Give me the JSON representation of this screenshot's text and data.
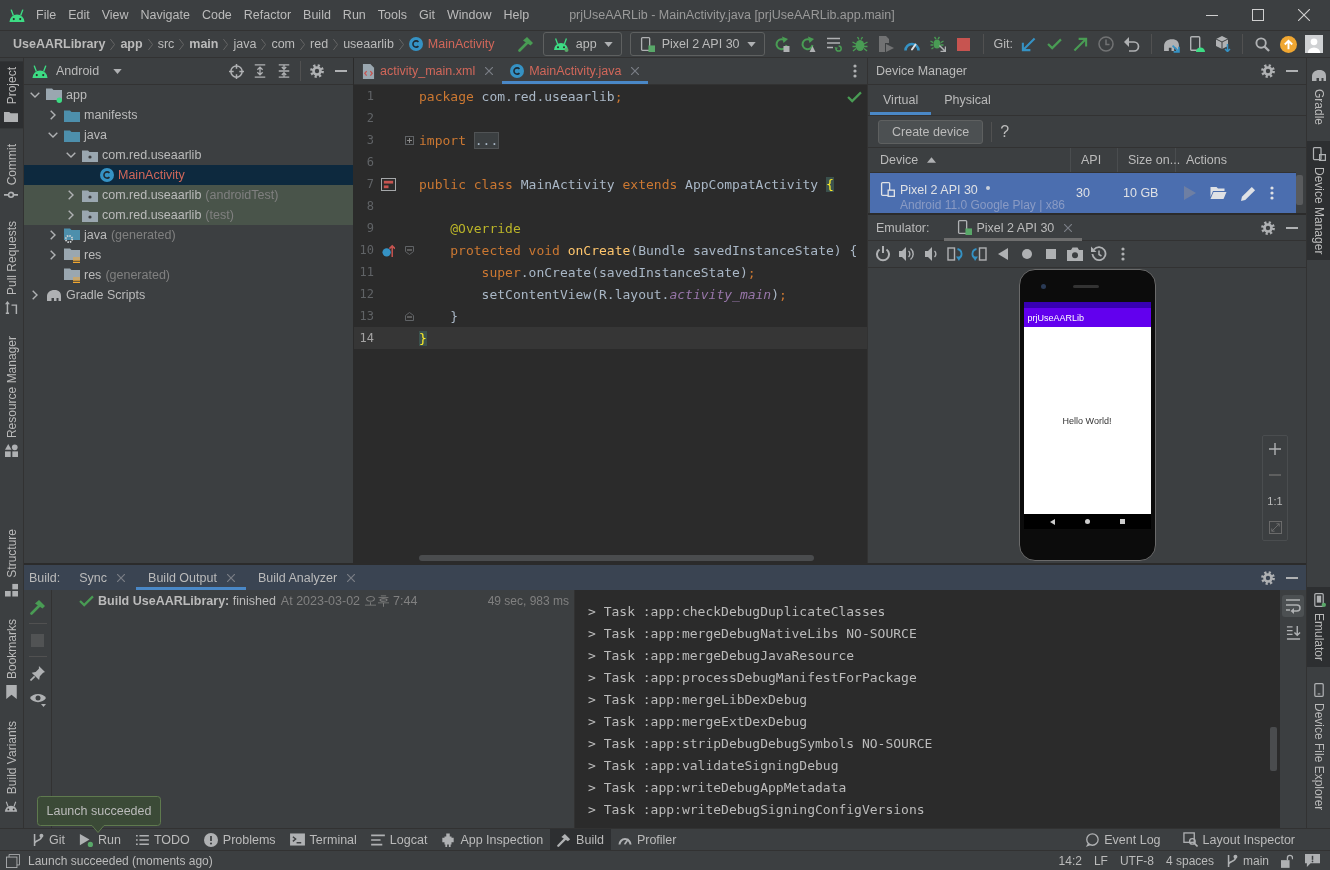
{
  "window": {
    "title": "prjUseAARLib - MainActivity.java [prjUseAARLib.app.main]"
  },
  "menu": [
    "File",
    "Edit",
    "View",
    "Navigate",
    "Code",
    "Refactor",
    "Build",
    "Run",
    "Tools",
    "Git",
    "Window",
    "Help"
  ],
  "breadcrumb": [
    {
      "label": "UseAARLibrary",
      "kind": "text",
      "emphasized": true
    },
    {
      "label": "app",
      "kind": "text",
      "emphasized": true
    },
    {
      "label": "src",
      "kind": "text",
      "emphasized": false
    },
    {
      "label": "main",
      "kind": "text",
      "emphasized": true
    },
    {
      "label": "java",
      "kind": "text",
      "emphasized": false
    },
    {
      "label": "com",
      "kind": "text",
      "emphasized": false
    },
    {
      "label": "red",
      "kind": "text",
      "emphasized": false
    },
    {
      "label": "useaarlib",
      "kind": "text",
      "emphasized": false
    },
    {
      "label": "MainActivity",
      "kind": "class",
      "emphasized": false
    }
  ],
  "toolbar": {
    "make": {
      "disabled": false
    },
    "run_config": "app",
    "device": "Pixel 2 API 30",
    "actions": [
      {
        "kind": "apply-restart",
        "disabled": false
      },
      {
        "kind": "apply-code",
        "disabled": false
      },
      {
        "kind": "tasks",
        "disabled": false
      },
      {
        "kind": "debug",
        "disabled": false
      },
      {
        "kind": "profile",
        "disabled": true
      },
      {
        "kind": "profiler",
        "disabled": false
      },
      {
        "kind": "attach",
        "disabled": false
      },
      {
        "kind": "stop",
        "disabled": false
      }
    ],
    "git_label": "Git:",
    "git_actions": [
      {
        "kind": "update",
        "disabled": false
      },
      {
        "kind": "commit",
        "disabled": false
      },
      {
        "kind": "push",
        "disabled": false
      },
      {
        "kind": "history",
        "disabled": true
      },
      {
        "kind": "rollback",
        "disabled": false
      }
    ]
  },
  "left_strip": {
    "top": [
      {
        "label": "Project",
        "kind": "project",
        "selected": true
      },
      {
        "label": "Commit",
        "kind": "commit",
        "selected": false
      },
      {
        "label": "Pull Requests",
        "kind": "pulls",
        "selected": false
      },
      {
        "label": "Resource Manager",
        "kind": "resources",
        "selected": false
      }
    ],
    "bottom": [
      {
        "label": "Structure",
        "kind": "structure",
        "selected": false
      },
      {
        "label": "Bookmarks",
        "kind": "bookmarks",
        "selected": false
      },
      {
        "label": "Build Variants",
        "kind": "variants",
        "selected": false
      }
    ]
  },
  "project": {
    "view": "Android",
    "tree": [
      {
        "label": "app",
        "kind": "module",
        "expanded": true,
        "selected": false,
        "test": false,
        "children": [
          {
            "label": "manifests",
            "kind": "folder",
            "expanded": false,
            "selected": false,
            "test": false
          },
          {
            "label": "java",
            "kind": "folder",
            "expanded": true,
            "selected": false,
            "test": false,
            "children": [
              {
                "label": "com.red.useaarlib",
                "kind": "package",
                "expanded": true,
                "selected": false,
                "test": false,
                "children": [
                  {
                    "label": "MainActivity",
                    "kind": "class",
                    "selected": true,
                    "test": false
                  }
                ]
              },
              {
                "label": "com.red.useaarlib",
                "note": "(androidTest)",
                "kind": "package",
                "expanded": false,
                "selected": false,
                "test": true
              },
              {
                "label": "com.red.useaarlib",
                "note": "(test)",
                "kind": "package",
                "expanded": false,
                "selected": false,
                "test": true
              }
            ]
          },
          {
            "label": "java",
            "note": "(generated)",
            "kind": "generated",
            "expanded": false,
            "selected": false,
            "test": false
          },
          {
            "label": "res",
            "kind": "resources",
            "expanded": false,
            "selected": false,
            "test": false
          },
          {
            "label": "res",
            "note": "(generated)",
            "kind": "resources",
            "selected": false,
            "test": false
          }
        ]
      },
      {
        "label": "Gradle Scripts",
        "kind": "gradle",
        "expanded": false,
        "selected": false,
        "test": false
      }
    ]
  },
  "editor": {
    "tabs": [
      {
        "label": "activity_main.xml",
        "kind": "xml",
        "selected": false
      },
      {
        "label": "MainActivity.java",
        "kind": "class",
        "selected": true
      }
    ],
    "lines": [
      {
        "number": "1",
        "current": false,
        "tokens": [
          {
            "text": "package",
            "kind": "keyword"
          },
          {
            "text": " com.red.useaarlib",
            "kind": "plain"
          },
          {
            "text": ";",
            "kind": "keyword"
          }
        ]
      },
      {
        "number": "2",
        "current": false
      },
      {
        "number": "3",
        "current": false,
        "fold": {
          "kind": "collapsed"
        },
        "tokens": [
          {
            "text": "import ",
            "kind": "keyword"
          },
          {
            "text": "...",
            "kind": "folded"
          }
        ]
      },
      {
        "number": "6",
        "current": false
      },
      {
        "number": "7",
        "current": false,
        "marker": {
          "kind": "layout"
        },
        "tokens": [
          {
            "text": "public class",
            "kind": "keyword"
          },
          {
            "text": " MainActivity ",
            "kind": "plain"
          },
          {
            "text": "extends",
            "kind": "keyword"
          },
          {
            "text": " AppCompatActivity ",
            "kind": "plain"
          },
          {
            "text": "{",
            "kind": "brace"
          }
        ]
      },
      {
        "number": "8",
        "current": false
      },
      {
        "number": "9",
        "current": false,
        "tokens": [
          {
            "text": "    @Override",
            "kind": "annotation"
          }
        ]
      },
      {
        "number": "10",
        "current": false,
        "marker": {
          "kind": "override"
        },
        "fold": {
          "kind": "open"
        },
        "tokens": [
          {
            "text": "    protected void ",
            "kind": "keyword"
          },
          {
            "text": "onCreate",
            "kind": "method"
          },
          {
            "text": "(Bundle savedInstanceState) {",
            "kind": "plain"
          }
        ]
      },
      {
        "number": "11",
        "current": false,
        "tokens": [
          {
            "text": "        super",
            "kind": "keyword"
          },
          {
            "text": ".onCreate(savedInstanceState)",
            "kind": "plain"
          },
          {
            "text": ";",
            "kind": "keyword"
          }
        ]
      },
      {
        "number": "12",
        "current": false,
        "tokens": [
          {
            "text": "        setContentView(R.layout.",
            "kind": "plain"
          },
          {
            "text": "activity_main",
            "kind": "field"
          },
          {
            "text": ")",
            "kind": "plain"
          },
          {
            "text": ";",
            "kind": "keyword"
          }
        ]
      },
      {
        "number": "13",
        "current": false,
        "fold": {
          "kind": "close"
        },
        "tokens": [
          {
            "text": "    }",
            "kind": "plain"
          }
        ]
      },
      {
        "number": "14",
        "current": true,
        "tokens": [
          {
            "text": "}",
            "kind": "brace"
          }
        ]
      }
    ]
  },
  "device_manager": {
    "title": "Device Manager",
    "tabs": [
      {
        "label": "Virtual",
        "selected": true
      },
      {
        "label": "Physical",
        "selected": false
      }
    ],
    "create_button": "Create device",
    "help": "?",
    "columns": [
      {
        "label": "Device",
        "sorted": true
      },
      {
        "label": "API",
        "sorted": false
      },
      {
        "label": "Size on...",
        "sorted": false
      },
      {
        "label": "Actions",
        "sorted": false
      }
    ],
    "rows": [
      {
        "name": "Pixel 2 API 30",
        "running": true,
        "details": "Android 11.0 Google Play | x86",
        "api": "30",
        "size": "10 GB",
        "selected": true
      }
    ]
  },
  "emulator": {
    "label": "Emulator:",
    "tabs": [
      {
        "label": "Pixel 2 API 30",
        "selected": true
      }
    ],
    "app_title": "prjUseAARLib",
    "app_text": "Hello World!",
    "zoom_label": "1:1"
  },
  "right_strip": {
    "top": [
      {
        "label": "Gradle",
        "kind": "gradle",
        "selected": false,
        "running": false
      },
      {
        "label": "Device Manager",
        "kind": "devices",
        "selected": true,
        "running": false
      }
    ],
    "bottom": [
      {
        "label": "Emulator",
        "kind": "emulator",
        "selected": true,
        "running": true
      },
      {
        "label": "Device File Explorer",
        "kind": "explorer",
        "selected": false,
        "running": false
      }
    ]
  },
  "build": {
    "label": "Build:",
    "tabs": [
      {
        "label": "Sync",
        "selected": false
      },
      {
        "label": "Build Output",
        "selected": true
      },
      {
        "label": "Build Analyzer",
        "selected": false
      }
    ],
    "tools": [
      {
        "kind": "rebuild",
        "disabled": false
      },
      {
        "kind": "stop",
        "disabled": true
      },
      {
        "kind": "pin",
        "disabled": false
      },
      {
        "kind": "filter",
        "disabled": false
      }
    ],
    "result": {
      "kind": "success",
      "message": "**Build UseAARLibrary:** finished",
      "time": "At 2023-03-02 오후 7:44",
      "duration": "49 sec, 983 ms"
    },
    "console": [
      "> Task :app:checkDebugDuplicateClasses",
      "> Task :app:mergeDebugNativeLibs NO-SOURCE",
      "> Task :app:mergeDebugJavaResource",
      "> Task :app:processDebugManifestForPackage",
      "> Task :app:mergeLibDexDebug",
      "> Task :app:mergeExtDexDebug",
      "> Task :app:stripDebugDebugSymbols NO-SOURCE",
      "> Task :app:validateSigningDebug",
      "> Task :app:writeDebugAppMetadata",
      "> Task :app:writeDebugSigningConfigVersions"
    ],
    "console_tools": [
      {
        "kind": "wrap",
        "selected": true
      },
      {
        "kind": "scroll-end",
        "selected": false
      }
    ]
  },
  "tool_windows": [
    {
      "label": "Git",
      "kind": "git",
      "selected": false,
      "running": false
    },
    {
      "label": "Run",
      "kind": "run",
      "selected": false,
      "running": true
    },
    {
      "label": "TODO",
      "kind": "todo",
      "selected": false,
      "running": false
    },
    {
      "label": "Problems",
      "kind": "problems",
      "selected": false,
      "running": false
    },
    {
      "label": "Terminal",
      "kind": "terminal",
      "selected": false,
      "running": false
    },
    {
      "label": "Logcat",
      "kind": "logcat",
      "selected": false,
      "running": false
    },
    {
      "label": "App Inspection",
      "kind": "inspection",
      "selected": false,
      "running": false
    },
    {
      "label": "Build",
      "kind": "build",
      "selected": true,
      "running": false
    },
    {
      "label": "Profiler",
      "kind": "profiler",
      "selected": false,
      "running": false
    }
  ],
  "tool_windows_right": [
    {
      "label": "Event Log",
      "kind": "events",
      "selected": false
    },
    {
      "label": "Layout Inspector",
      "kind": "layout",
      "selected": false
    }
  ],
  "notification": {
    "text": "Launch succeeded"
  },
  "status_bar": {
    "message": "Launch succeeded (moments ago)",
    "position": "14:2",
    "line_separator": "LF",
    "encoding": "UTF-8",
    "indent": "4 spaces",
    "branch": "main"
  }
}
